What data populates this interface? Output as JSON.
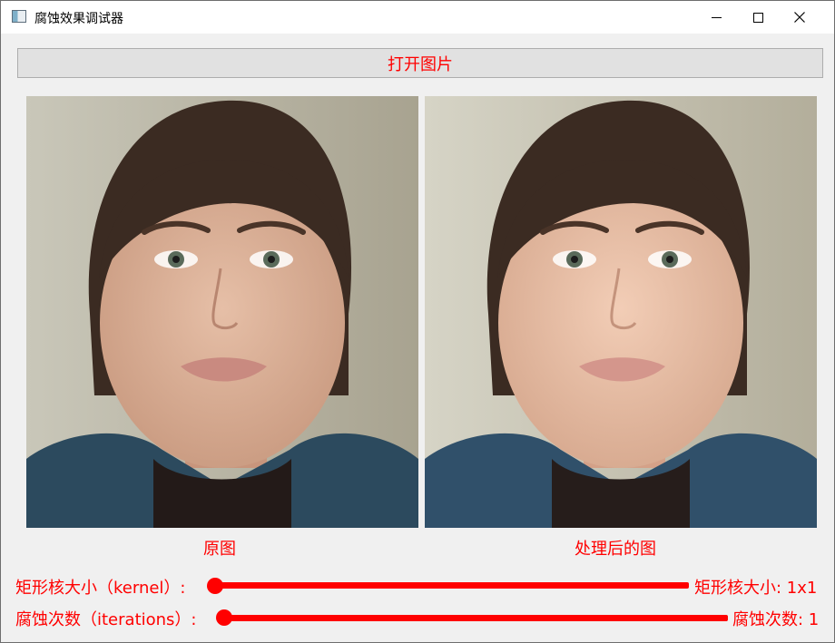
{
  "window": {
    "title": "腐蚀效果调试器"
  },
  "toolbar": {
    "open_button_label": "打开图片"
  },
  "images": {
    "original_caption": "原图",
    "processed_caption": "处理后的图"
  },
  "controls": {
    "kernel": {
      "label": "矩形核大小（kernel）:",
      "value_text": "矩形核大小: 1x1",
      "value": 1
    },
    "iterations": {
      "label": "腐蚀次数（iterations）:",
      "value_text": "腐蚀次数: 1",
      "value": 1
    }
  },
  "colors": {
    "accent": "#ff0000",
    "window_bg": "#f0f0f0"
  }
}
